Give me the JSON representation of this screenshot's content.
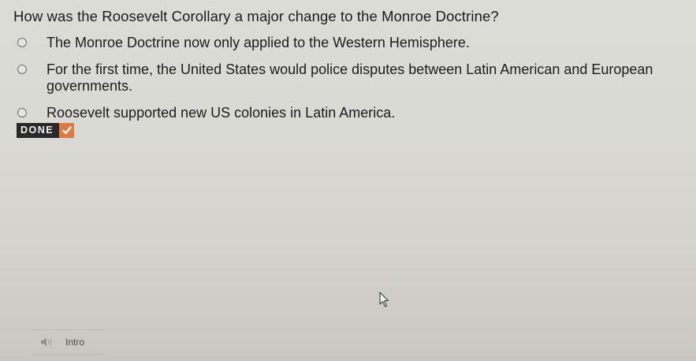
{
  "question": {
    "text": "How was the Roosevelt Corollary a major change to the Monroe Doctrine?"
  },
  "options": [
    {
      "label": "The Monroe Doctrine now only applied to the Western Hemisphere.",
      "selected": false
    },
    {
      "label": "For the first time, the United States would police disputes between Latin American and European governments.",
      "selected": false
    },
    {
      "label": "Roosevelt supported new US colonies in Latin America.",
      "selected": false
    }
  ],
  "done": {
    "label": "DONE",
    "icon": "checkmark-icon",
    "accent": "#e07a3f"
  },
  "intro": {
    "label": "Intro",
    "icon": "speaker-icon"
  },
  "cursor": {
    "icon": "mouse-pointer-icon"
  }
}
